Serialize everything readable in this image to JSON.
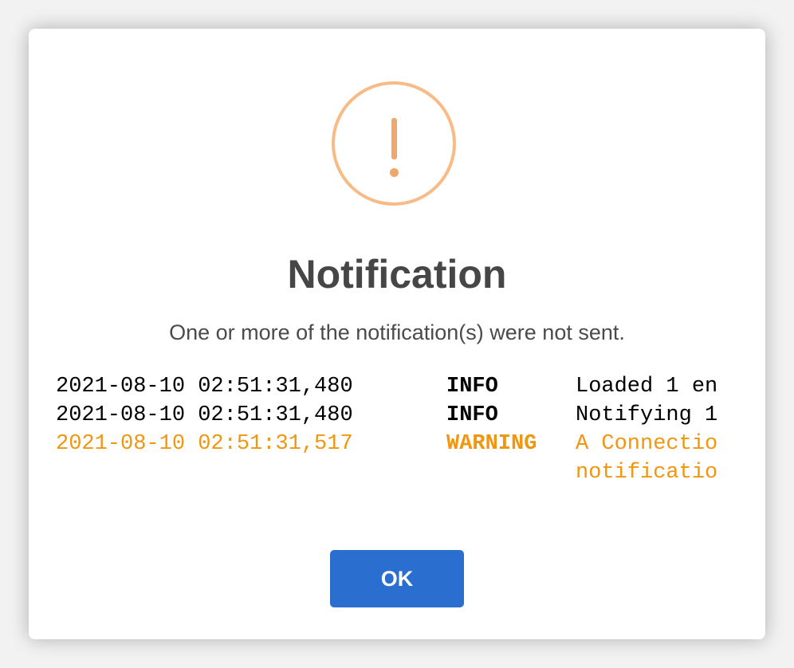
{
  "dialog": {
    "title": "Notification",
    "message": "One or more of the notification(s) were not sent.",
    "icon": "warning-exclamation-icon",
    "ok_label": "OK"
  },
  "log": [
    {
      "timestamp": "2021-08-10 02:51:31,480",
      "level": "INFO",
      "message": "Loaded 1 en"
    },
    {
      "timestamp": "2021-08-10 02:51:31,480",
      "level": "INFO",
      "message": "Notifying 1"
    },
    {
      "timestamp": "2021-08-10 02:51:31,517",
      "level": "WARNING",
      "message": "A Connectio\nnotificatio"
    }
  ],
  "colors": {
    "accent": "#2a6fd0",
    "warning_icon": "#f8bb86",
    "warning_text": "#f0960f",
    "title": "#464646"
  }
}
